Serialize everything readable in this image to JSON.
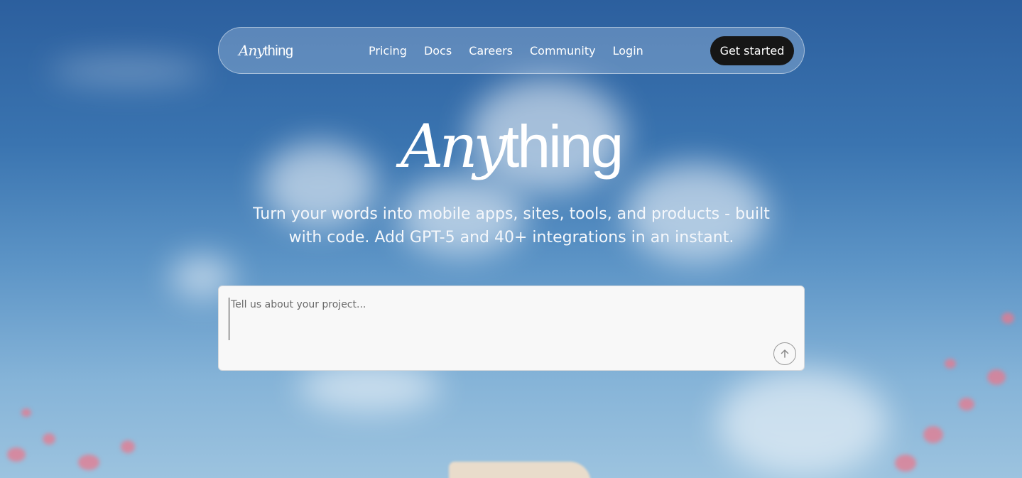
{
  "nav": {
    "logo": {
      "italic": "Any",
      "regular": "thing"
    },
    "links": [
      "Pricing",
      "Docs",
      "Careers",
      "Community",
      "Login"
    ],
    "cta": "Get started"
  },
  "hero": {
    "title": {
      "italic": "Any",
      "regular": "thing"
    },
    "subtitle": "Turn your words into mobile apps, sites, tools, and products - built with code. Add GPT-5 and 40+ integrations in an instant."
  },
  "prompt": {
    "placeholder": "Tell us about your project...",
    "value": "",
    "submit_icon": "arrow-up-icon"
  },
  "colors": {
    "cta_background": "#161616",
    "sky": "#3a74b0",
    "prompt_background": "#f8f8f8"
  }
}
